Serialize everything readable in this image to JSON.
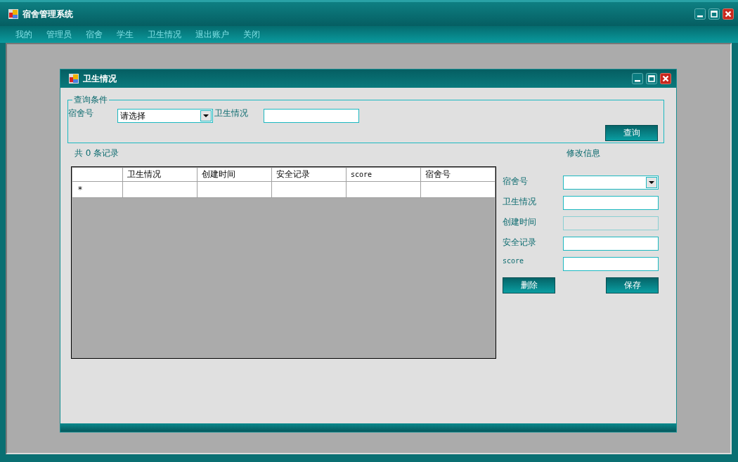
{
  "app_window": {
    "title": "宿舍管理系统"
  },
  "menu": [
    {
      "label": "我的"
    },
    {
      "label": "管理员"
    },
    {
      "label": "宿舍"
    },
    {
      "label": "学生"
    },
    {
      "label": "卫生情况"
    },
    {
      "label": "退出账户"
    },
    {
      "label": "关闭"
    }
  ],
  "child_window": {
    "title": "卫生情况",
    "query": {
      "legend": "查询条件",
      "dorm_label": "宿舍号",
      "dorm_value": "请选择",
      "hygiene_label": "卫生情况",
      "button": "查询"
    },
    "record_count": "共 0 条记录",
    "table": {
      "columns": [
        "卫生情况",
        "创建时间",
        "安全记录",
        "score",
        "宿舍号"
      ],
      "new_row_marker": "*"
    },
    "edit": {
      "title": "修改信息",
      "fields": [
        {
          "label": "宿舍号",
          "kind": "combo",
          "disabled": false
        },
        {
          "label": "卫生情况",
          "kind": "text",
          "disabled": false
        },
        {
          "label": "创建时间",
          "kind": "text",
          "disabled": true
        },
        {
          "label": "安全记录",
          "kind": "text",
          "disabled": false
        },
        {
          "label": "score",
          "kind": "text",
          "disabled": false
        }
      ],
      "delete_button": "删除",
      "save_button": "保存"
    }
  }
}
